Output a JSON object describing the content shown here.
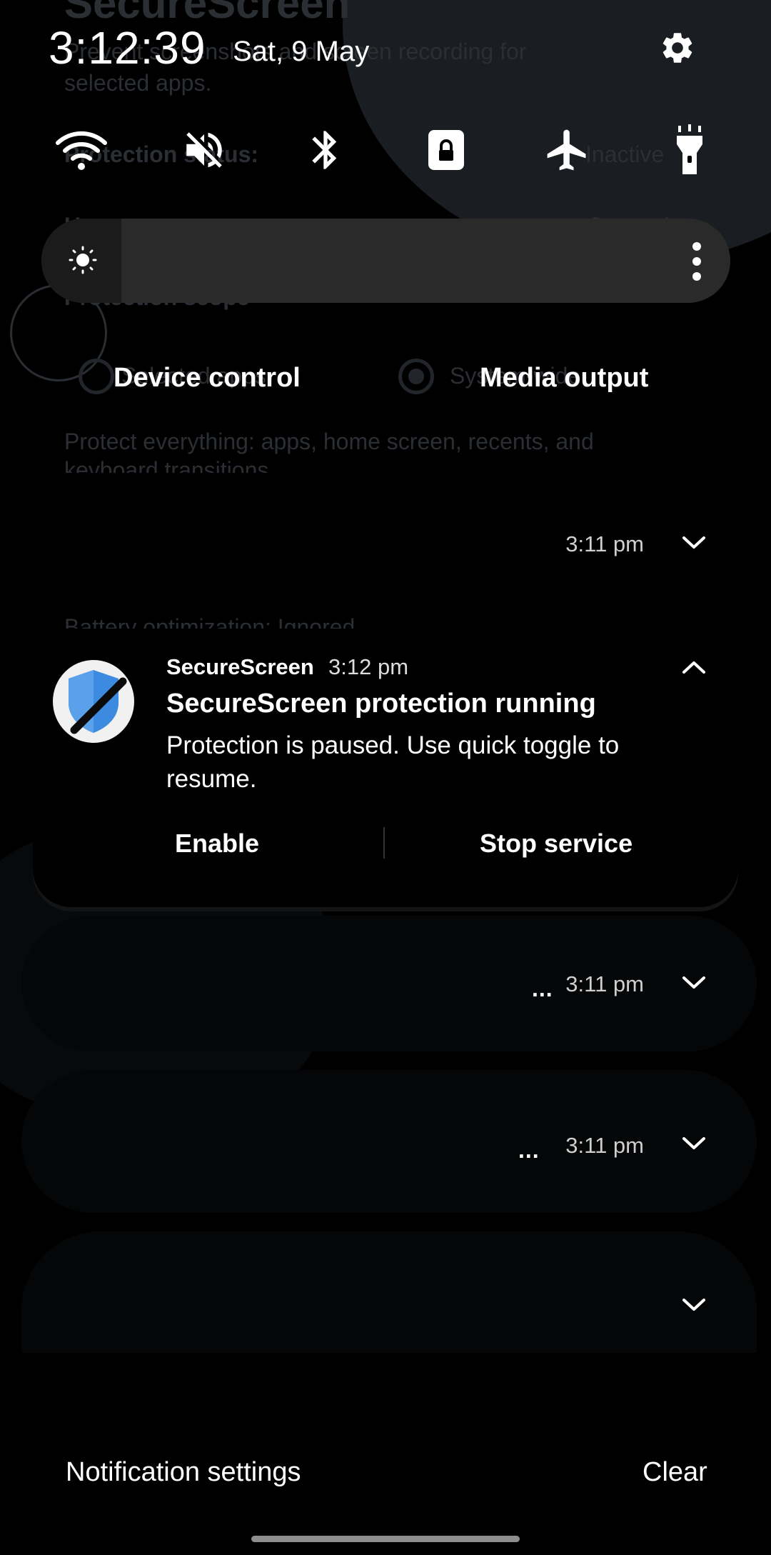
{
  "background_app": {
    "title": "SecureScreen",
    "subtitle_line1": "Prevent screenshots and screen recording for",
    "subtitle_line2": "selected apps.",
    "protection_status_label": "Protection status:",
    "protection_status_value": "Inactive",
    "usage_access_label": "Usage access:",
    "usage_access_value": "Granted",
    "protection_scope_label": "Protection scope",
    "scope_option_1": "Selected apps",
    "scope_option_2": "System-wide",
    "scope_description_line1": "Protect everything: apps, home screen, recents, and",
    "scope_description_line2": "keyboard transitions",
    "battery_label": "Battery optimization: Ignored"
  },
  "header": {
    "clock": "3:12:39",
    "date": "Sat, 9 May",
    "settings_icon": "gear-icon"
  },
  "quick_toggles": [
    {
      "name": "wifi",
      "icon": "wifi-icon"
    },
    {
      "name": "sound",
      "icon": "mute-icon"
    },
    {
      "name": "bluetooth",
      "icon": "bluetooth-icon"
    },
    {
      "name": "screen-lock",
      "icon": "lock-icon"
    },
    {
      "name": "airplane",
      "icon": "airplane-icon"
    },
    {
      "name": "flashlight",
      "icon": "flashlight-icon"
    }
  ],
  "brightness": {
    "icon": "sun-icon",
    "more_icon": "more-vertical-icon"
  },
  "panels": {
    "device_control": "Device control",
    "media_output": "Media output"
  },
  "notifications": [
    {
      "time": "3:11 pm",
      "ellipsis": ""
    },
    {
      "time": "3:11 pm",
      "ellipsis": "..."
    },
    {
      "time": "3:11 pm",
      "ellipsis": "..."
    }
  ],
  "expanded_notification": {
    "app_name": "SecureScreen",
    "time": "3:12 pm",
    "title": "SecureScreen protection running",
    "body": "Protection is paused. Use quick toggle to resume.",
    "actions": [
      "Enable",
      "Stop service"
    ]
  },
  "footer": {
    "notification_settings": "Notification settings",
    "clear": "Clear"
  },
  "colors": {
    "background": "#000000",
    "shield_blue": "#3d8be0",
    "slider_track": "#2a2a2a"
  }
}
